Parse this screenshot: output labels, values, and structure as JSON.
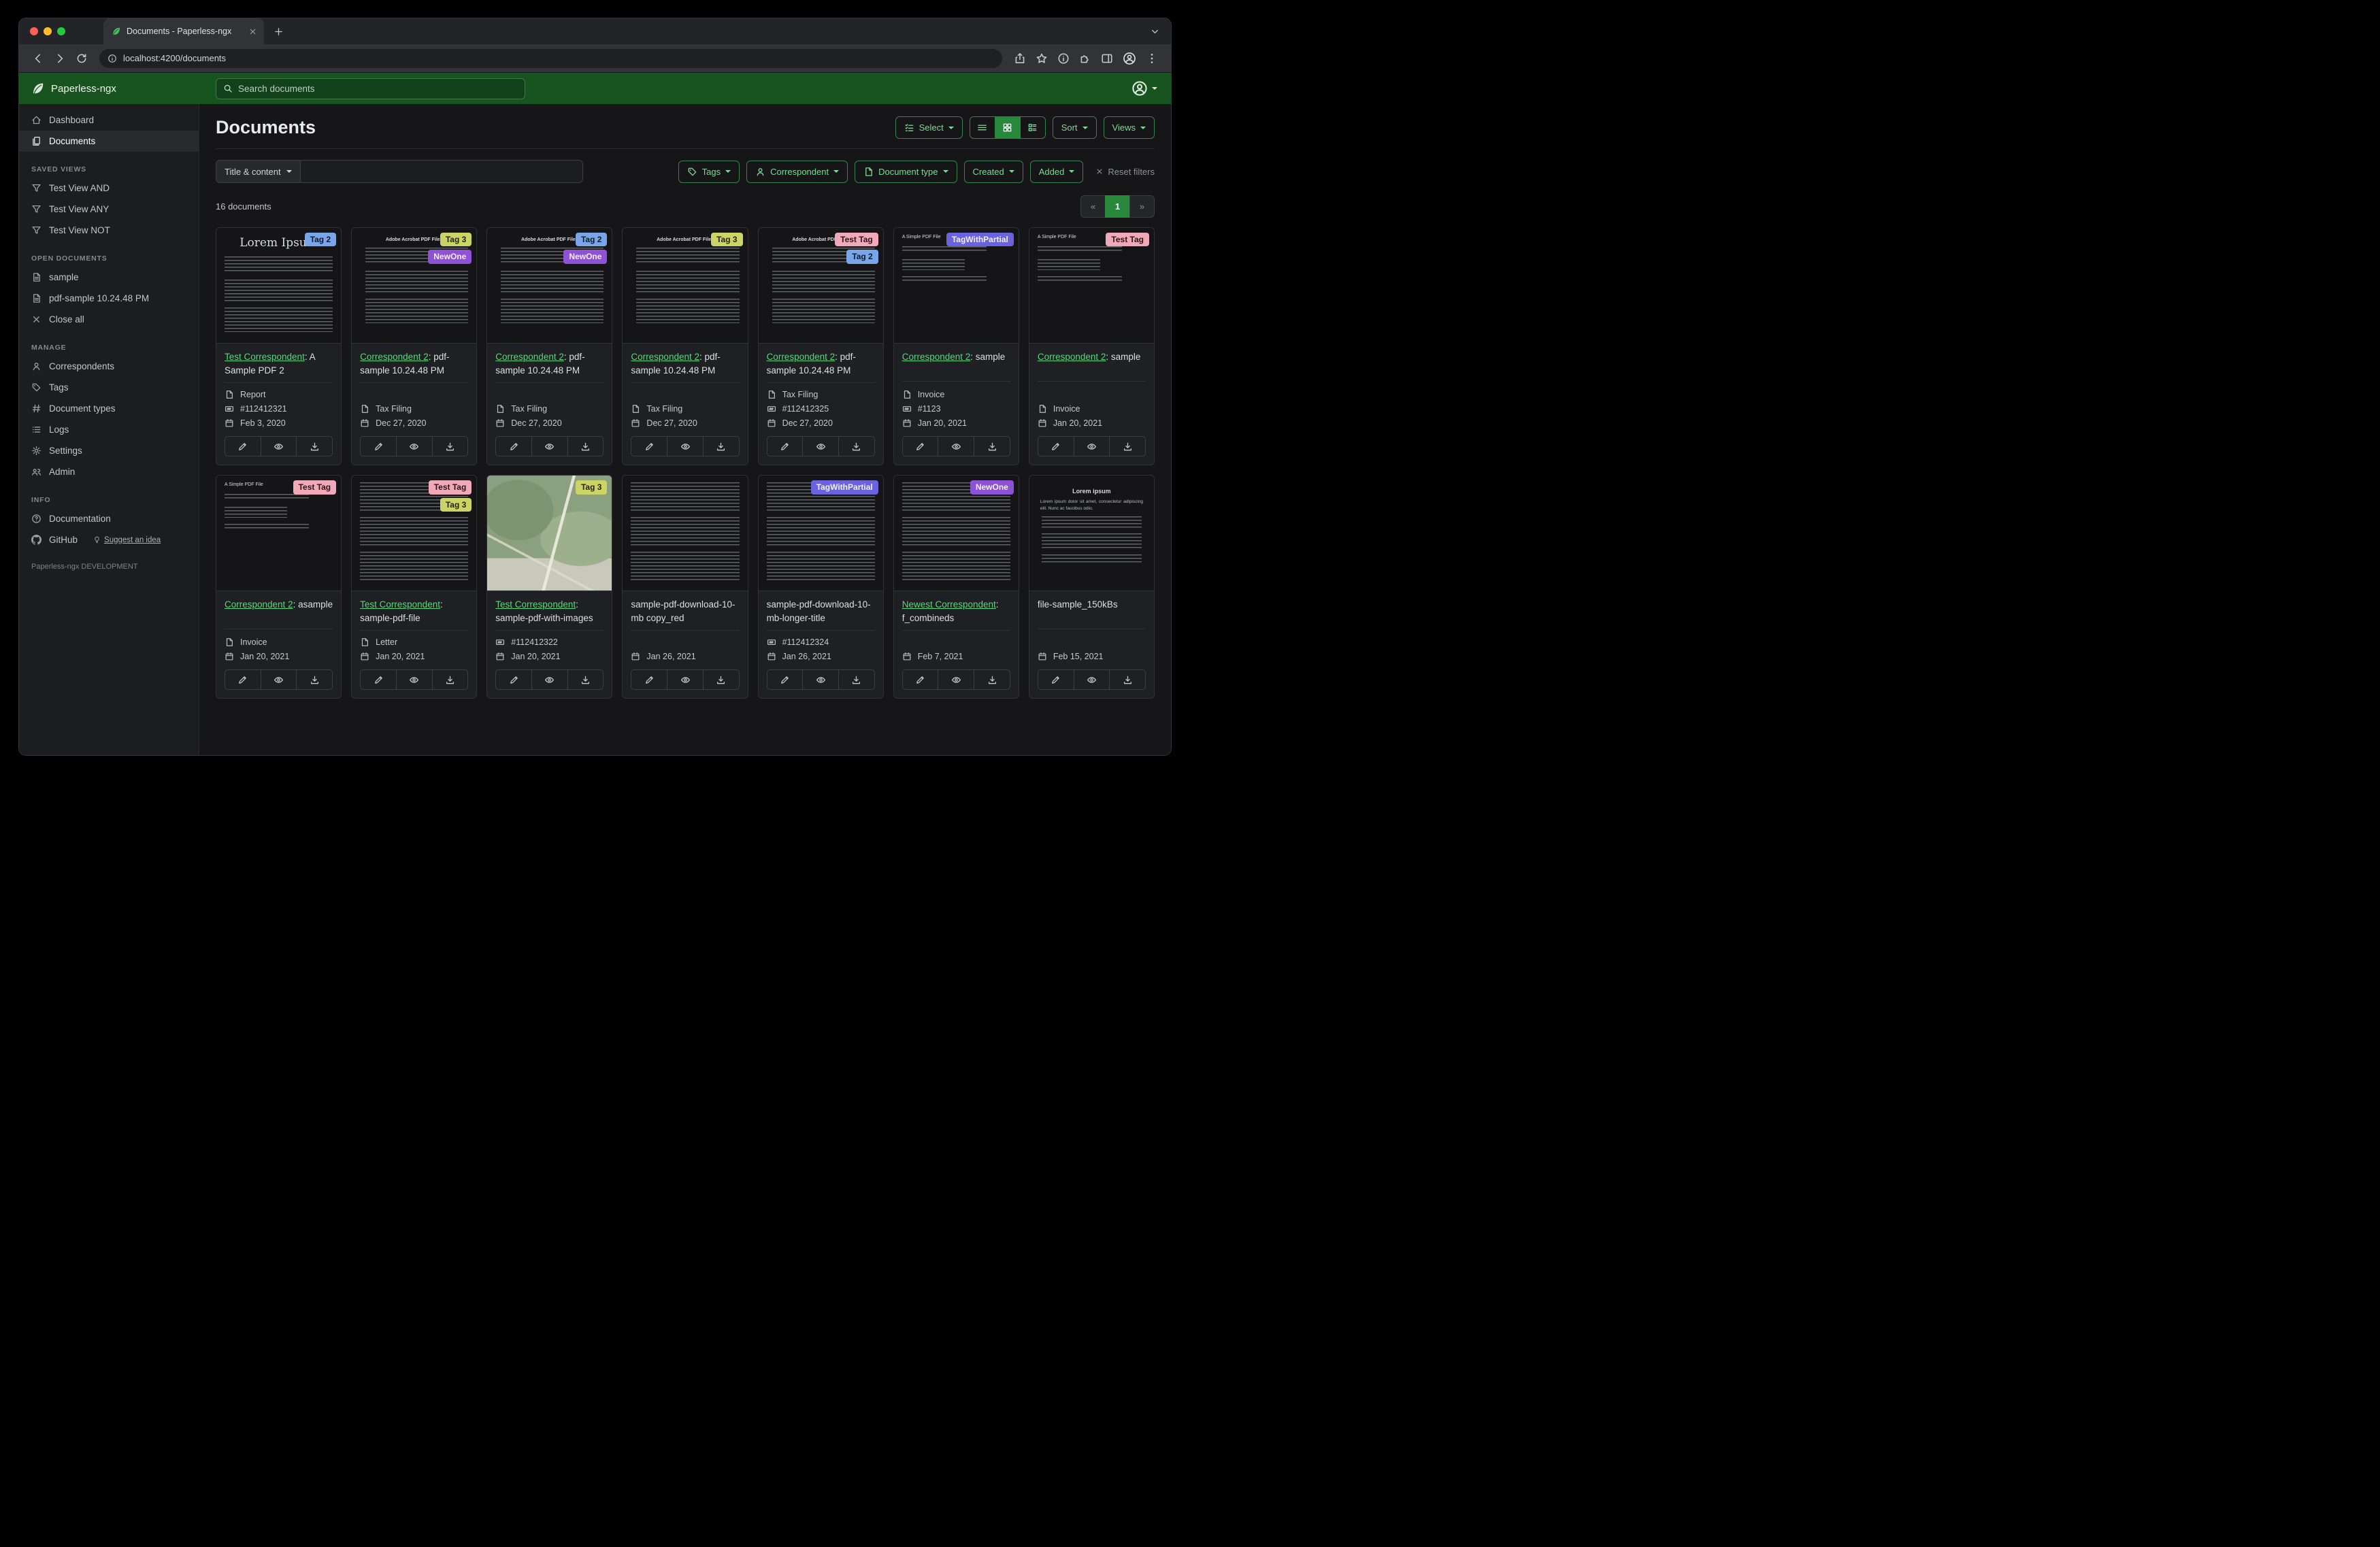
{
  "browser": {
    "tab_title": "Documents - Paperless-ngx",
    "url": "localhost:4200/documents"
  },
  "navbar": {
    "brand": "Paperless-ngx",
    "search_placeholder": "Search documents"
  },
  "sidebar": {
    "primary": [
      {
        "label": "Dashboard",
        "icon": "dashboard",
        "active": false
      },
      {
        "label": "Documents",
        "icon": "documents",
        "active": true
      }
    ],
    "sections": [
      {
        "title": "SAVED VIEWS",
        "items": [
          {
            "label": "Test View AND",
            "icon": "funnel"
          },
          {
            "label": "Test View ANY",
            "icon": "funnel"
          },
          {
            "label": "Test View NOT",
            "icon": "funnel"
          }
        ]
      },
      {
        "title": "OPEN DOCUMENTS",
        "items": [
          {
            "label": "sample",
            "icon": "file-text"
          },
          {
            "label": "pdf-sample 10.24.48 PM",
            "icon": "file-text"
          },
          {
            "label": "Close all",
            "icon": "close"
          }
        ]
      },
      {
        "title": "MANAGE",
        "items": [
          {
            "label": "Correspondents",
            "icon": "person"
          },
          {
            "label": "Tags",
            "icon": "tag"
          },
          {
            "label": "Document types",
            "icon": "hash"
          },
          {
            "label": "Logs",
            "icon": "list"
          },
          {
            "label": "Settings",
            "icon": "gear"
          },
          {
            "label": "Admin",
            "icon": "users"
          }
        ]
      },
      {
        "title": "INFO",
        "items": [
          {
            "label": "Documentation",
            "icon": "question"
          },
          {
            "label": "GitHub",
            "icon": "github",
            "extra": {
              "label": "Suggest an idea",
              "icon": "bulb"
            }
          }
        ]
      }
    ],
    "footer": "Paperless-ngx DEVELOPMENT"
  },
  "header": {
    "title": "Documents",
    "select_label": "Select",
    "sort_label": "Sort",
    "views_label": "Views"
  },
  "filters": {
    "field_selector": "Title & content",
    "buttons": [
      {
        "label": "Tags",
        "icon": "tag"
      },
      {
        "label": "Correspondent",
        "icon": "person"
      },
      {
        "label": "Document type",
        "icon": "file"
      },
      {
        "label": "Created",
        "icon": null
      },
      {
        "label": "Added",
        "icon": null
      }
    ],
    "reset_label": "Reset filters"
  },
  "results": {
    "count_label": "16 documents",
    "pagination": {
      "prev": "«",
      "current": "1",
      "next": "»"
    }
  },
  "accent_colors": {
    "navbar_green": "#17541f",
    "button_green": "#27873a",
    "link_green": "#5ad67e"
  },
  "tag_styles": {
    "Tag 2": {
      "bg": "#79a6e8",
      "fg": "#0c1a2d"
    },
    "Tag 3": {
      "bg": "#cbd465",
      "fg": "#23260a"
    },
    "Test Tag": {
      "bg": "#efa9b8",
      "fg": "#33101a"
    },
    "NewOne": {
      "bg": "#8e52d6",
      "fg": "#f4edfc"
    },
    "TagWithPartial": {
      "bg": "#6a63dd",
      "fg": "#efeefc"
    }
  },
  "documents": [
    {
      "tags": [
        "Tag 2"
      ],
      "correspondent": "Test Correspondent",
      "title_rest": ": A Sample PDF 2",
      "doc_type": "Report",
      "asn": "#112412321",
      "date": "Feb 3, 2020",
      "thumb": {
        "kind": "lorem",
        "heading": "Lorem Ipsum",
        "body": null
      }
    },
    {
      "tags": [
        "Tag 3",
        "NewOne"
      ],
      "correspondent": "Correspondent 2",
      "title_rest": ": pdf-sample 10.24.48 PM",
      "doc_type": "Tax Filing",
      "asn": null,
      "date": "Dec 27, 2020",
      "thumb": {
        "kind": "adobe",
        "heading": "Adobe Acrobat PDF Files",
        "body": null
      }
    },
    {
      "tags": [
        "Tag 2",
        "NewOne"
      ],
      "correspondent": "Correspondent 2",
      "title_rest": ": pdf-sample 10.24.48 PM",
      "doc_type": "Tax Filing",
      "asn": null,
      "date": "Dec 27, 2020",
      "thumb": {
        "kind": "adobe",
        "heading": "Adobe Acrobat PDF Files",
        "body": null
      }
    },
    {
      "tags": [
        "Tag 3"
      ],
      "correspondent": "Correspondent 2",
      "title_rest": ": pdf-sample 10.24.48 PM",
      "doc_type": "Tax Filing",
      "asn": null,
      "date": "Dec 27, 2020",
      "thumb": {
        "kind": "adobe",
        "heading": "Adobe Acrobat PDF Files",
        "body": null
      }
    },
    {
      "tags": [
        "Test Tag",
        "Tag 2"
      ],
      "correspondent": "Correspondent 2",
      "title_rest": ": pdf-sample 10.24.48 PM",
      "doc_type": "Tax Filing",
      "asn": "#112412325",
      "date": "Dec 27, 2020",
      "thumb": {
        "kind": "adobe",
        "heading": "Adobe Acrobat PDF Files",
        "body": null
      }
    },
    {
      "tags": [
        "TagWithPartial"
      ],
      "correspondent": "Correspondent 2",
      "title_rest": ": sample",
      "doc_type": "Invoice",
      "asn": "#1123",
      "date": "Jan 20, 2021",
      "thumb": {
        "kind": "simple",
        "heading": "A Simple PDF File",
        "body": null
      }
    },
    {
      "tags": [
        "Test Tag"
      ],
      "correspondent": "Correspondent 2",
      "title_rest": ": sample",
      "doc_type": "Invoice",
      "asn": null,
      "date": "Jan 20, 2021",
      "thumb": {
        "kind": "simple",
        "heading": "A Simple PDF File",
        "body": null
      }
    },
    {
      "tags": [
        "Test Tag"
      ],
      "correspondent": "Correspondent 2",
      "title_rest": ": asample",
      "doc_type": "Invoice",
      "asn": null,
      "date": "Jan 20, 2021",
      "thumb": {
        "kind": "simple",
        "heading": "A Simple PDF File",
        "body": null
      }
    },
    {
      "tags": [
        "Test Tag",
        "Tag 3"
      ],
      "correspondent": "Test Correspondent",
      "title_rest": ": sample-pdf-file",
      "doc_type": "Letter",
      "asn": null,
      "date": "Jan 20, 2021",
      "thumb": {
        "kind": "text",
        "heading": null,
        "body": null
      }
    },
    {
      "tags": [
        "Tag 3"
      ],
      "correspondent": "Test Correspondent",
      "title_rest": ": sample-pdf-with-images",
      "doc_type": null,
      "asn": "#112412322",
      "date": "Jan 20, 2021",
      "thumb": {
        "kind": "map",
        "heading": null,
        "body": null
      }
    },
    {
      "tags": [],
      "correspondent": null,
      "title_rest": "sample-pdf-download-10-mb copy_red",
      "doc_type": null,
      "asn": null,
      "date": "Jan 26, 2021",
      "thumb": {
        "kind": "text",
        "heading": null,
        "body": null
      }
    },
    {
      "tags": [
        "TagWithPartial"
      ],
      "correspondent": null,
      "title_rest": "sample-pdf-download-10-mb-longer-title",
      "doc_type": null,
      "asn": "#112412324",
      "date": "Jan 26, 2021",
      "thumb": {
        "kind": "text",
        "heading": null,
        "body": null
      }
    },
    {
      "tags": [
        "NewOne"
      ],
      "correspondent": "Newest Correspondent",
      "title_rest": ": f_combineds",
      "doc_type": null,
      "asn": null,
      "date": "Feb 7, 2021",
      "thumb": {
        "kind": "text",
        "heading": null,
        "body": null
      }
    },
    {
      "tags": [],
      "correspondent": null,
      "title_rest": "file-sample_150kBs",
      "doc_type": null,
      "asn": null,
      "date": "Feb 15, 2021",
      "thumb": {
        "kind": "lorem2",
        "heading": "Lorem ipsum",
        "body": "Lorem ipsum dolor sit amet, consectetur adipiscing elit. Nunc ac faucibus odio."
      }
    }
  ]
}
